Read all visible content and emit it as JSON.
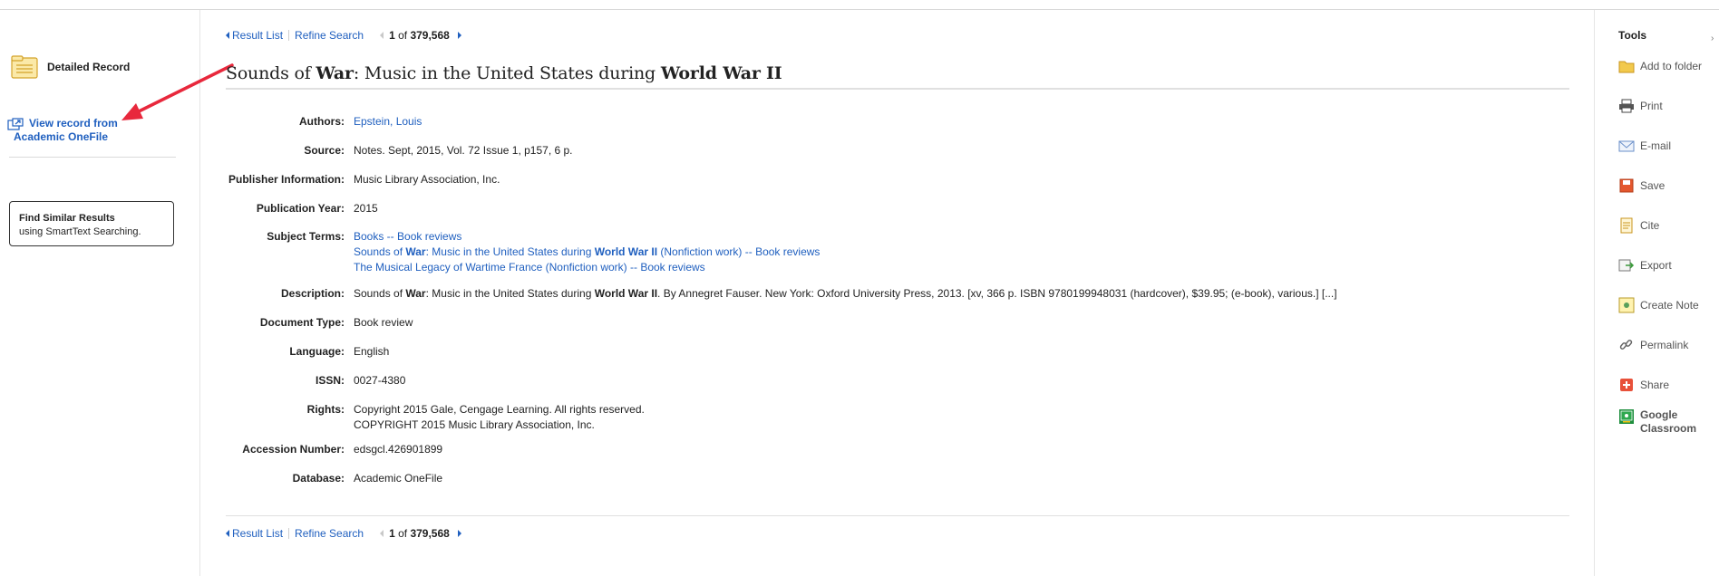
{
  "left": {
    "detailed_record": "Detailed Record",
    "view_record_line1": "View record from",
    "view_record_line2": "Academic OneFile",
    "find_similar_title": "Find Similar Results",
    "find_similar_sub": "using SmartText Searching."
  },
  "nav": {
    "result_list": "Result List",
    "refine_search": "Refine Search",
    "position": "1",
    "of": " of ",
    "total": "379,568"
  },
  "record": {
    "title_1": "Sounds of ",
    "title_2": "War",
    "title_3": ": Music in the United States during ",
    "title_4": "World War II",
    "authors_label": "Authors:",
    "authors": "Epstein, Louis",
    "source_label": "Source:",
    "source": "Notes. Sept, 2015, Vol. 72 Issue 1, p157, 6 p.",
    "publisher_label": "Publisher Information:",
    "publisher": "Music Library Association, Inc.",
    "year_label": "Publication Year:",
    "year": "2015",
    "subjects_label": "Subject Terms:",
    "subject_1": "Books -- Book reviews",
    "subject_2a": "Sounds of ",
    "subject_2b": "War",
    "subject_2c": ": Music in the United States during ",
    "subject_2d": "World War II",
    "subject_2e": " (Nonfiction work) -- Book reviews",
    "subject_3": "The Musical Legacy of Wartime France (Nonfiction work) -- Book reviews",
    "description_label": "Description:",
    "description_a": "Sounds of ",
    "description_b": "War",
    "description_c": ": Music in the United States during ",
    "description_d": "World War II",
    "description_e": ". By Annegret Fauser. New York: Oxford University Press, 2013. [xv, 366 p. ISBN 9780199948031 (hardcover), $39.95; (e-book), various.] [...]",
    "doctype_label": "Document Type:",
    "doctype": "Book review",
    "language_label": "Language:",
    "language": "English",
    "issn_label": "ISSN:",
    "issn": "0027-4380",
    "rights_label": "Rights:",
    "rights_1": "Copyright 2015 Gale, Cengage Learning. All rights reserved.",
    "rights_2": "COPYRIGHT 2015 Music Library Association, Inc.",
    "accession_label": "Accession Number:",
    "accession": "edsgcl.426901899",
    "database_label": "Database:",
    "database": "Academic OneFile"
  },
  "tools": {
    "title": "Tools",
    "add_to_folder": "Add to folder",
    "print": "Print",
    "email": "E-mail",
    "save": "Save",
    "cite": "Cite",
    "export": "Export",
    "create_note": "Create Note",
    "permalink": "Permalink",
    "share": "Share",
    "google_1": "Google",
    "google_2": "Classroom",
    "collapse": "›"
  },
  "colors": {
    "link": "#1f5fbf",
    "arrow": "#e8283c",
    "folder_icon": "#e0b43a"
  }
}
